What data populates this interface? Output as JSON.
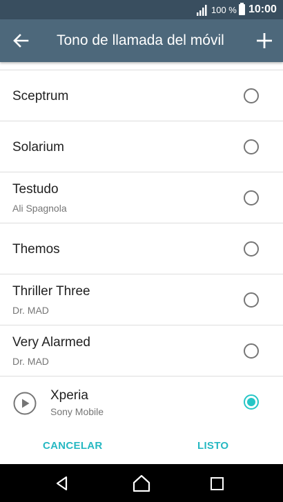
{
  "status": {
    "battery_percent": "100 %",
    "time": "10:00"
  },
  "appbar": {
    "title": "Tono de llamada del móvil",
    "back_icon": "arrow-left-icon",
    "add_icon": "plus-icon"
  },
  "ringtones": [
    {
      "name": "Sceptrum",
      "subtitle": "",
      "selected": false
    },
    {
      "name": "Solarium",
      "subtitle": "",
      "selected": false
    },
    {
      "name": "Testudo",
      "subtitle": "Ali Spagnola",
      "selected": false
    },
    {
      "name": "Themos",
      "subtitle": "",
      "selected": false
    },
    {
      "name": "Thriller Three",
      "subtitle": "Dr. MAD",
      "selected": false
    },
    {
      "name": "Very Alarmed",
      "subtitle": "Dr. MAD",
      "selected": false
    },
    {
      "name": "Xperia",
      "subtitle": "Sony Mobile",
      "selected": true
    }
  ],
  "actions": {
    "cancel": "CANCELAR",
    "ok": "LISTO"
  },
  "colors": {
    "statusbar": "#394e5f",
    "appbar": "#4d687b",
    "accent": "#26c6c6"
  }
}
